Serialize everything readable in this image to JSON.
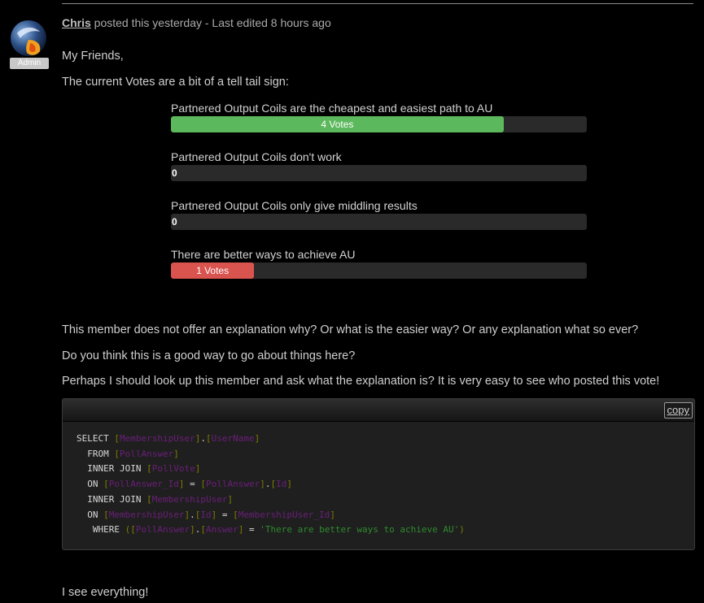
{
  "post": {
    "author": "Chris",
    "meta_text": " posted this yesterday - Last edited 8 hours ago",
    "badge": "Admin"
  },
  "body": {
    "greeting": "My Friends,",
    "intro": "The current Votes are a bit of a tell tail sign:",
    "para1": "This member does not offer an explanation why? Or what is the easier way? Or any explanation what so ever?",
    "para2": "Do you think this is a good way to go about things here?",
    "para3": "Perhaps I should look up this member and ask what the explanation is? It is very easy to see who posted this vote!",
    "closing": "I see everything!"
  },
  "poll": {
    "options": [
      {
        "question": "Partnered Output Coils are the cheapest and easiest path to AU",
        "label": "4 Votes",
        "fraction": 0.8,
        "color": "#5cb85c"
      },
      {
        "question": "Partnered Output Coils don't work",
        "label": "0",
        "fraction": 0,
        "color": "#5cb85c"
      },
      {
        "question": "Partnered Output Coils only give middling results",
        "label": "0",
        "fraction": 0,
        "color": "#5cb85c"
      },
      {
        "question": "There are better ways to achieve AU",
        "label": "1 Votes",
        "fraction": 0.2,
        "color": "#d9534f"
      }
    ]
  },
  "code": {
    "copy_label": "copy",
    "lines": [
      "SELECT [MembershipUser].[UserName]",
      "  FROM [PollAnswer]",
      "  INNER JOIN [PollVote]",
      "  ON [PollAnswer_Id] = [PollAnswer].[Id]",
      "  INNER JOIN [MembershipUser]",
      "  ON [MembershipUser].[Id] = [MembershipUser_Id]",
      "   WHERE ([PollAnswer].[Answer] = 'There are better ways to achieve AU')"
    ]
  }
}
